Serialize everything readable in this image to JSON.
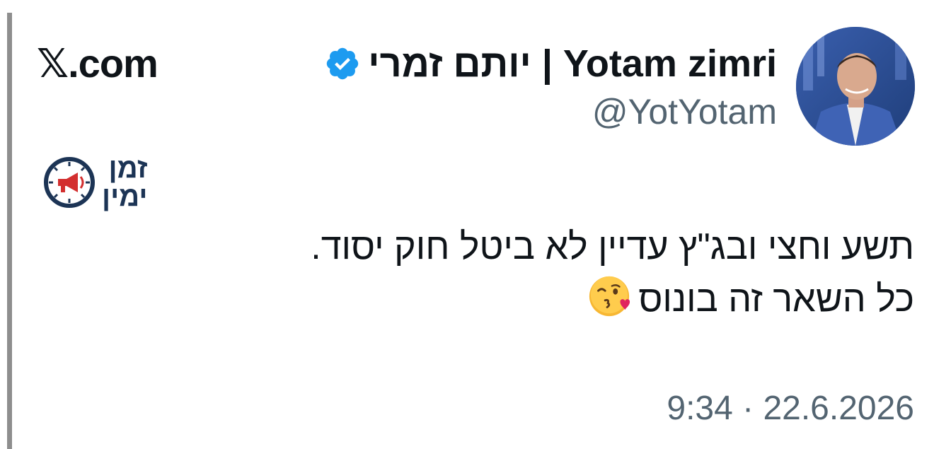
{
  "source": {
    "site_label": "𝕏.com"
  },
  "author": {
    "display_name": "יותם זמרי | Yotam zimri",
    "handle": "@YotYotam",
    "verified": true,
    "verified_color": "#1d9bf0",
    "avatar_icon": "profile-photo"
  },
  "logo": {
    "line1": "זמן",
    "line2": "ימין",
    "icon": "clock-megaphone-icon",
    "color": "#1c3455",
    "accent": "#d32f2f"
  },
  "tweet": {
    "line1": "תשע וחצי ובג\"ץ עדיין לא ביטל חוק יסוד.",
    "line2": "כל השאר זה בונוס",
    "emoji": "face-blowing-a-kiss"
  },
  "timestamp": "9:34 · 22.6.2026"
}
